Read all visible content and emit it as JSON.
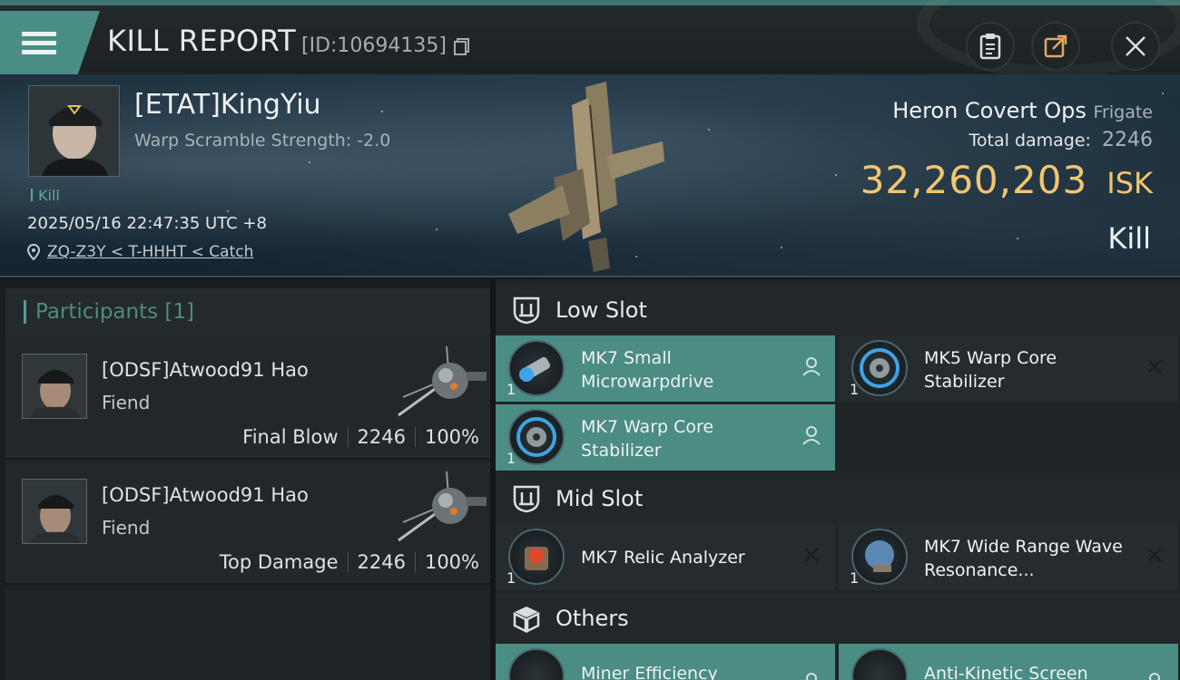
{
  "header": {
    "title": "KILL REPORT",
    "report_id": "[ID:10694135]"
  },
  "victim": {
    "name": "[ETAT]KingYiu",
    "warp_scramble": "Warp Scramble Strength: -2.0",
    "tag": "Kill",
    "timestamp": "2025/05/16 22:47:35 UTC +8",
    "location": "ZQ-Z3Y < T-HHHT < Catch",
    "ship_name": "Heron Covert Ops",
    "ship_class": "Frigate",
    "total_damage_label": "Total damage:",
    "total_damage": "2246",
    "isk_value": "32,260,203",
    "isk_unit": "ISK",
    "outcome": "Kill"
  },
  "participants": {
    "title": "Participants [1]",
    "rows": [
      {
        "name": "[ODSF]Atwood91 Hao",
        "ship": "Fiend",
        "role": "Final Blow",
        "damage": "2246",
        "percent": "100%"
      },
      {
        "name": "[ODSF]Atwood91 Hao",
        "ship": "Fiend",
        "role": "Top Damage",
        "damage": "2246",
        "percent": "100%"
      }
    ]
  },
  "slots": {
    "low": {
      "title": "Low Slot",
      "items": [
        {
          "name": "MK7 Small Microwarpdrive",
          "qty": "1",
          "status": "person-icon"
        },
        {
          "name": "MK5 Warp Core Stabilizer",
          "qty": "1",
          "status": "close-icon"
        },
        {
          "name": "MK7 Warp Core Stabilizer",
          "qty": "1",
          "status": "person-icon"
        }
      ]
    },
    "mid": {
      "title": "Mid Slot",
      "items": [
        {
          "name": "MK7 Relic Analyzer",
          "qty": "1",
          "status": "close-icon"
        },
        {
          "name": "MK7 Wide Range Wave Resonance...",
          "qty": "1",
          "status": "close-icon"
        }
      ]
    },
    "others": {
      "title": "Others",
      "items": [
        {
          "name": "Miner Efficiency",
          "qty": "",
          "status": "person-icon"
        },
        {
          "name": "Anti-Kinetic Screen",
          "qty": "",
          "status": "person-icon"
        }
      ]
    }
  },
  "colors": {
    "accent_teal": "#4b8c83",
    "isk_gold": "#f2c66d",
    "panel_dark": "#1f2426"
  }
}
